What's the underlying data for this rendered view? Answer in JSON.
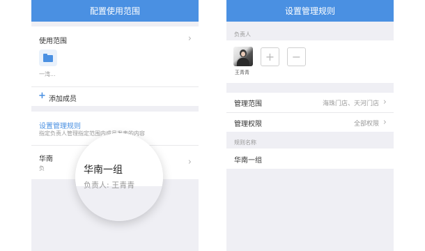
{
  "left": {
    "title": "配置使用范围",
    "scope_label": "使用范围",
    "dept_label": "一湾...",
    "add_member": "添加成员",
    "rule_title": "设置管理规则",
    "rule_desc": "指定负责人管理指定范围内成员发表的内容",
    "group_name_partial": "华南",
    "group_sub_partial": "负",
    "magnifier": {
      "name": "华南一组",
      "sub": "负责人: 王青青"
    }
  },
  "right": {
    "title": "设置管理规则",
    "owner_header": "负责人",
    "owner_name": "王青青",
    "scope_label": "管理范围",
    "scope_value": "海珠门店、天河门店",
    "perm_label": "管理权限",
    "perm_value": "全部权限",
    "rule_name_header": "规则名称",
    "rule_name_value": "华南一组"
  },
  "colors": {
    "accent": "#4a90e2",
    "bg": "#efeff4"
  },
  "icons": {
    "folder": "folder-icon",
    "plus": "plus-icon",
    "minus": "minus-icon",
    "chevron": "chevron-right-icon",
    "avatar": "user-avatar"
  }
}
